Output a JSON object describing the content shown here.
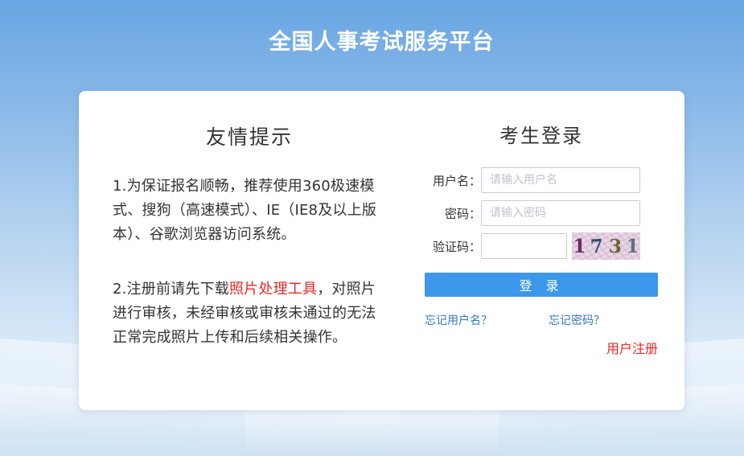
{
  "page": {
    "title": "全国人事考试服务平台"
  },
  "tips": {
    "heading": "友情提示",
    "paragraph1": "1.为保证报名顺畅，推荐使用360极速模式、搜狗（高速模式）、IE（IE8及以上版本）、谷歌浏览器访问系统。",
    "paragraph2_prefix": "2.注册前请先下载",
    "paragraph2_link": "照片处理工具",
    "paragraph2_suffix": "，对照片进行审核，未经审核或审核未通过的无法正常完成照片上传和后续相关操作。"
  },
  "login": {
    "heading": "考生登录",
    "username_label": "用户名：",
    "username_placeholder": "请输入用户名",
    "username_value": "",
    "password_label": "密码：",
    "password_placeholder": "请输入密码",
    "password_value": "",
    "captcha_label": "验证码：",
    "captcha_value": "",
    "captcha_digits": {
      "d0": "1",
      "d1": "7",
      "d2": "3",
      "d3": "1"
    },
    "login_button": "登 录",
    "forgot_username": "忘记用户名？",
    "forgot_password": "忘记密码？",
    "register": "用户注册"
  },
  "colors": {
    "accent_blue": "#3d97eb",
    "link_blue": "#3478c0",
    "alert_red": "#f42424",
    "bg_top": "#68a6e2",
    "bg_bottom": "#cfe2f2",
    "captcha_digit_colors": {
      "d0": "#6d2a62",
      "d1": "#33506b",
      "d2": "#70603a",
      "d3": "#5f6f80"
    }
  }
}
